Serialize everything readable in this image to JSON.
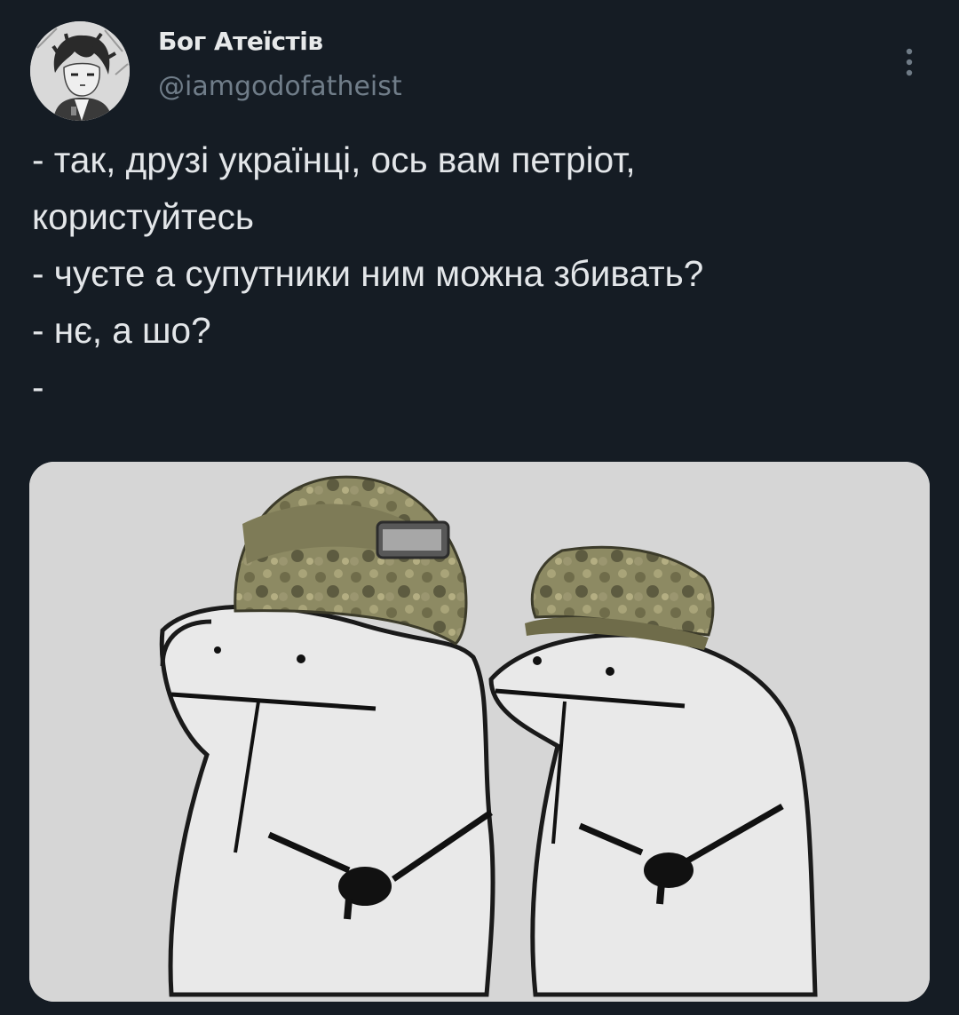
{
  "tweet": {
    "author": {
      "name": "Бог Атеїстів",
      "handle": "@iamgodofatheist",
      "avatar_icon": "avatar-image"
    },
    "more_icon": "more-vertical-icon",
    "text_lines": [
      "- так, друзі українці, ось вам петріот,",
      "користуйтесь",
      "- чуєте а супутники ним можна збивать?",
      "- нє, а шо?",
      "-"
    ],
    "media": {
      "description_icon": "meme-image"
    }
  },
  "colors": {
    "background": "#151c24",
    "text": "#e7e9ea",
    "handle": "#707d89",
    "media_bg": "#d5d5d5"
  }
}
